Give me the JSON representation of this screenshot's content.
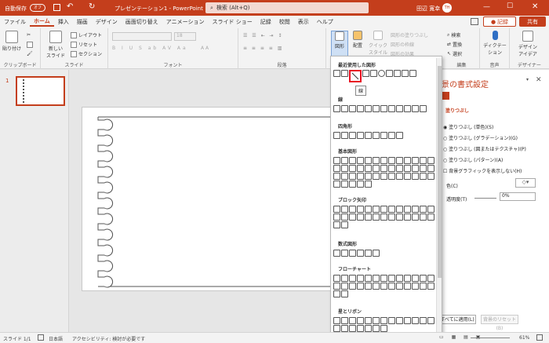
{
  "titlebar": {
    "autosave_label": "自動保存",
    "autosave_state": "オフ",
    "doc_title": "プレゼンテーション1 - PowerPoint",
    "search_placeholder": "検索 (Alt+Q)",
    "user_name": "田辺 寛幸",
    "user_initials": "TH"
  },
  "tabs": [
    "ファイル",
    "ホーム",
    "挿入",
    "描画",
    "デザイン",
    "画面切り替え",
    "アニメーション",
    "スライド ショー",
    "記録",
    "校閲",
    "表示",
    "ヘルプ"
  ],
  "active_tab": "ホーム",
  "buttons": {
    "record": "記録",
    "share": "共有"
  },
  "ribbon": {
    "clipboard": {
      "paste": "貼り付け",
      "label": "クリップボード"
    },
    "slides": {
      "new_slide": "新しい\nスライド",
      "layout": "レイアウト",
      "reset": "リセット",
      "section": "セクション",
      "label": "スライド"
    },
    "font": {
      "label": "フォント",
      "size": "18"
    },
    "paragraph": {
      "label": "段落"
    },
    "drawing": {
      "shapes": "図形",
      "arrange": "配置",
      "quick_styles": "クイック\nスタイル",
      "fill": "図形の塗りつぶし",
      "outline": "図形の枠線",
      "effects": "図形の効果"
    },
    "editing": {
      "find": "検索",
      "replace": "置換",
      "select": "選択",
      "label": "編集"
    },
    "voice": {
      "dictate": "ディクテーション",
      "label": "音声"
    },
    "designer": {
      "ideas": "デザイン\nアイデア",
      "label": "デザイナー"
    }
  },
  "thumbnail_number": "1",
  "gallery": {
    "sections": [
      "最近使用した図形",
      "線",
      "四角形",
      "基本図形",
      "ブロック矢印",
      "数式図形",
      "フローチャート",
      "星とリボン"
    ],
    "tooltip": "線"
  },
  "format_pane": {
    "title": "景の書式設定",
    "section": "塗りつぶし",
    "options": [
      "塗りつぶし (単色)(S)",
      "塗りつぶし (グラデーション)(G)",
      "塗りつぶし (図またはテクスチャ)(P)",
      "塗りつぶし (パターン)(A)"
    ],
    "hide_graphics": "背景グラフィックを表示しない(H)",
    "color_label": "色(C)",
    "transparency_label": "透明度(T)",
    "transparency_value": "0%",
    "apply_all": "すべてに適用(L)",
    "reset_bg": "背景のリセット(B)"
  },
  "status": {
    "slide": "スライド 1/1",
    "language": "日本語",
    "accessibility": "アクセシビリティ: 検討が必要です",
    "zoom": "61%"
  }
}
